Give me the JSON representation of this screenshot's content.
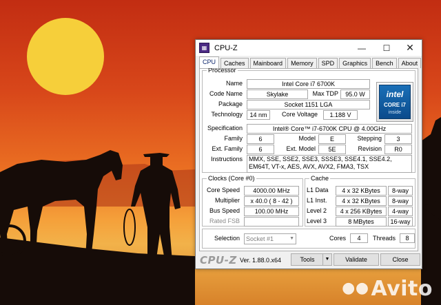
{
  "window": {
    "title": "CPU-Z",
    "icon": "cpu-z-app-icon"
  },
  "tabs": [
    "CPU",
    "Caches",
    "Mainboard",
    "Memory",
    "SPD",
    "Graphics",
    "Bench",
    "About"
  ],
  "processor": {
    "legend": "Processor",
    "name_label": "Name",
    "name": "Intel Core i7 6700K",
    "codename_label": "Code Name",
    "codename": "Skylake",
    "maxtdp_label": "Max TDP",
    "maxtdp": "95.0 W",
    "package_label": "Package",
    "package": "Socket 1151 LGA",
    "technology_label": "Technology",
    "technology": "14 nm",
    "corevoltage_label": "Core Voltage",
    "corevoltage": "1.188 V",
    "specification_label": "Specification",
    "specification": "Intel® Core™ i7-6700K CPU @ 4.00GHz",
    "family_label": "Family",
    "family": "6",
    "model_label": "Model",
    "model": "E",
    "stepping_label": "Stepping",
    "stepping": "3",
    "extfamily_label": "Ext. Family",
    "extfamily": "6",
    "extmodel_label": "Ext. Model",
    "extmodel": "5E",
    "revision_label": "Revision",
    "revision": "R0",
    "instructions_label": "Instructions",
    "instructions": "MMX, SSE, SSE2, SSE3, SSSE3, SSE4.1, SSE4.2, EM64T, VT-x, AES, AVX, AVX2, FMA3, TSX",
    "logo": {
      "brand": "intel",
      "model": "CORE i7",
      "tagline": "inside"
    }
  },
  "clocks": {
    "legend": "Clocks (Core #0)",
    "corespeed_label": "Core Speed",
    "corespeed": "4000.00 MHz",
    "multiplier_label": "Multiplier",
    "multiplier": "x 40.0 ( 8 - 42 )",
    "busspeed_label": "Bus Speed",
    "busspeed": "100.00 MHz",
    "ratedfsb_label": "Rated FSB",
    "ratedfsb": ""
  },
  "cache": {
    "legend": "Cache",
    "rows": [
      {
        "label": "L1 Data",
        "size": "4 x 32 KBytes",
        "way": "8-way"
      },
      {
        "label": "L1 Inst.",
        "size": "4 x 32 KBytes",
        "way": "8-way"
      },
      {
        "label": "Level 2",
        "size": "4 x 256 KBytes",
        "way": "4-way"
      },
      {
        "label": "Level 3",
        "size": "8 MBytes",
        "way": "16-way"
      }
    ]
  },
  "selection": {
    "label": "Selection",
    "value": "Socket #1",
    "cores_label": "Cores",
    "cores": "4",
    "threads_label": "Threads",
    "threads": "8"
  },
  "footer": {
    "brand": "CPU-Z",
    "version": "Ver. 1.88.0.x64",
    "tools": "Tools",
    "validate": "Validate",
    "close": "Close"
  },
  "watermark": "Avito",
  "colors": {
    "sky_top": "#c22d12",
    "sky_mid": "#ea6e22",
    "sun": "#f6cf3a",
    "silhouette": "#1a0f0a",
    "intel_blue": "#0b4b8c"
  }
}
